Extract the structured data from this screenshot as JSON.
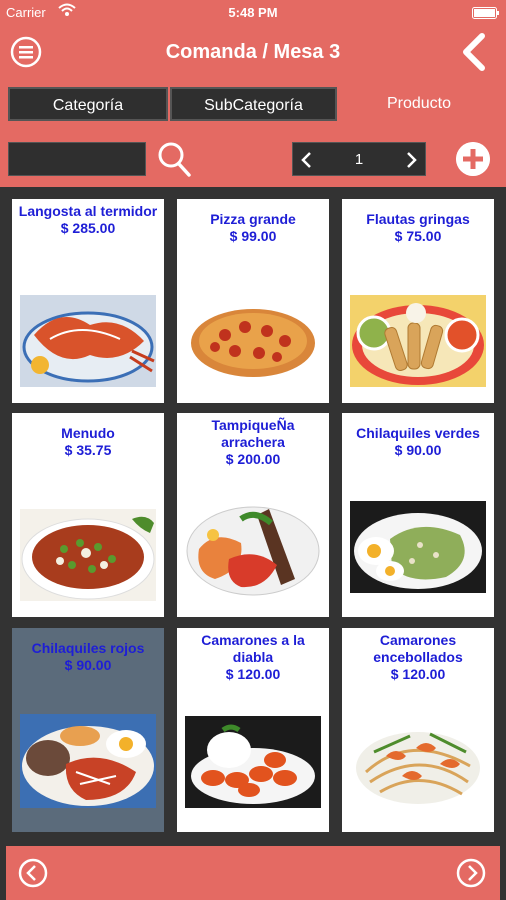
{
  "status": {
    "carrier": "Carrier",
    "time": "5:48 PM"
  },
  "header": {
    "title": "Comanda / Mesa 3"
  },
  "tabs": [
    {
      "label": "Categoría"
    },
    {
      "label": "SubCategoría"
    },
    {
      "label": "Producto"
    }
  ],
  "search": {
    "value": ""
  },
  "pager": {
    "page": "1"
  },
  "products": [
    {
      "name": "Langosta al termidor",
      "price": "$ 285.00",
      "photo": "lobster-photo"
    },
    {
      "name": "Pizza grande",
      "price": "$ 99.00",
      "photo": "pizza-photo"
    },
    {
      "name": "Flautas gringas",
      "price": "$ 75.00",
      "photo": "flautas-photo"
    },
    {
      "name": "Menudo",
      "price": "$ 35.75",
      "photo": "menudo-photo"
    },
    {
      "name": "TampiqueÑa arrachera",
      "price": "$ 200.00",
      "photo": "tampiquena-photo"
    },
    {
      "name": "Chilaquiles verdes",
      "price": "$ 90.00",
      "photo": "chilaquiles-verdes-photo"
    },
    {
      "name": "Chilaquiles rojos",
      "price": "$ 90.00",
      "photo": "chilaquiles-rojos-photo"
    },
    {
      "name": "Camarones a la diabla",
      "price": "$ 120.00",
      "photo": "camarones-diabla-photo"
    },
    {
      "name": "Camarones encebollados",
      "price": "$ 120.00",
      "photo": "camarones-encebollados-photo"
    }
  ],
  "colors": {
    "header_bg": "#e46a63",
    "grid_bg": "#333333",
    "product_text": "#1e1ed6",
    "selected_card": "#5b6b7b"
  },
  "icons": [
    "menu-icon",
    "back-chevron-icon",
    "search-icon",
    "add-icon",
    "page-prev-icon",
    "page-next-icon",
    "nav-prev-icon",
    "nav-next-icon"
  ]
}
